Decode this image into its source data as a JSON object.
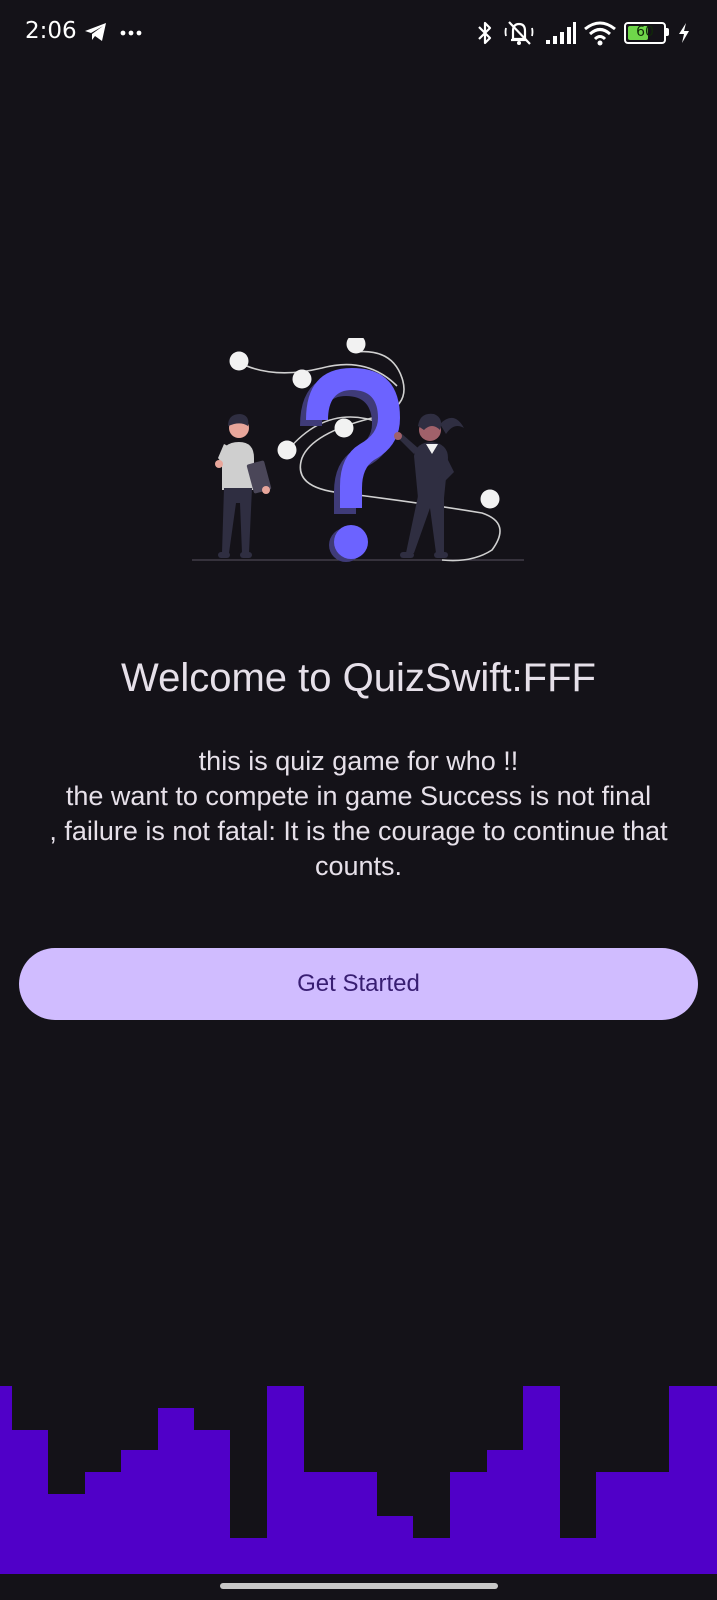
{
  "status_bar": {
    "time": "2:06",
    "battery_level": "60",
    "battery_fraction": 0.6,
    "icons": [
      "telegram-icon",
      "more-dots-icon",
      "bluetooth-icon",
      "silent-icon",
      "signal-icon",
      "wifi-icon",
      "battery-icon",
      "charging-icon"
    ]
  },
  "welcome": {
    "title": "Welcome to QuizSwift:FFF",
    "description_lines": [
      "this is quiz game for who !!",
      " the want to compete in game Success is not final",
      ", failure is not fatal: It is the courage to continue that",
      "counts."
    ]
  },
  "actions": {
    "get_started_label": "Get Started"
  },
  "illustration": {
    "name": "two people with a question mark",
    "accent_color": "#6c63ff"
  },
  "colors": {
    "background": "#141218",
    "button_bg": "#d0bcff",
    "button_text": "#381e72",
    "skyline": "#5000c8",
    "text": "#e6e0e9"
  }
}
